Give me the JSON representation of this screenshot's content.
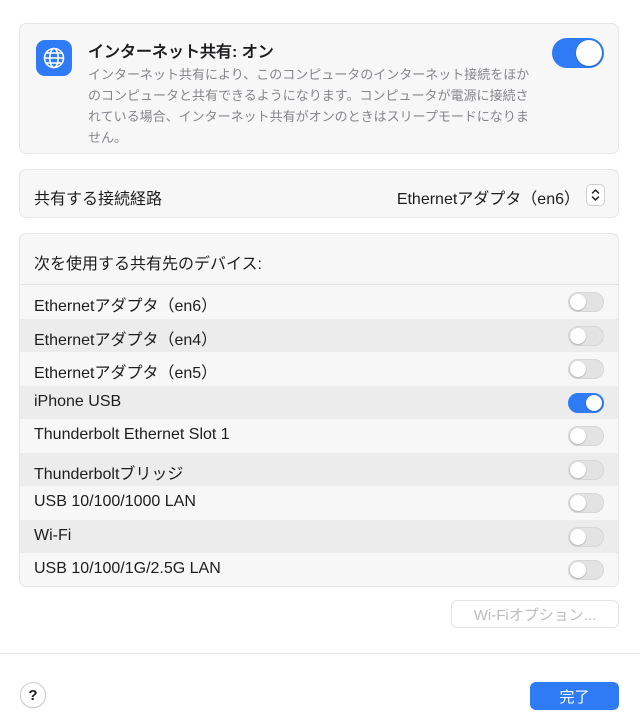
{
  "header": {
    "title": "インターネット共有: オン",
    "description": "インターネット共有により、このコンピュータのインターネット接続をほかのコンピュータと共有できるようになります。コンピュータが電源に接続されている場合、インターネット共有がオンのときはスリープモードになりません。",
    "toggle_on": true,
    "icon": "globe-icon"
  },
  "connection": {
    "label": "共有する接続経路",
    "value": "Ethernetアダプタ（en6）"
  },
  "devices": {
    "header": "次を使用する共有先のデバイス:",
    "items": [
      {
        "name": "Ethernetアダプタ（en6）",
        "on": false
      },
      {
        "name": "Ethernetアダプタ（en4）",
        "on": false
      },
      {
        "name": "Ethernetアダプタ（en5）",
        "on": false
      },
      {
        "name": "iPhone USB",
        "on": true
      },
      {
        "name": "Thunderbolt Ethernet Slot 1",
        "on": false
      },
      {
        "name": "Thunderboltブリッジ",
        "on": false
      },
      {
        "name": "USB 10/100/1000 LAN",
        "on": false
      },
      {
        "name": "Wi-Fi",
        "on": false
      },
      {
        "name": "USB 10/100/1G/2.5G LAN",
        "on": false
      }
    ]
  },
  "buttons": {
    "wifi_options": "Wi-Fiオプション...",
    "help": "?",
    "done": "完了"
  },
  "colors": {
    "accent": "#2f7bf6",
    "toggle_off": "#e3e3e3"
  }
}
